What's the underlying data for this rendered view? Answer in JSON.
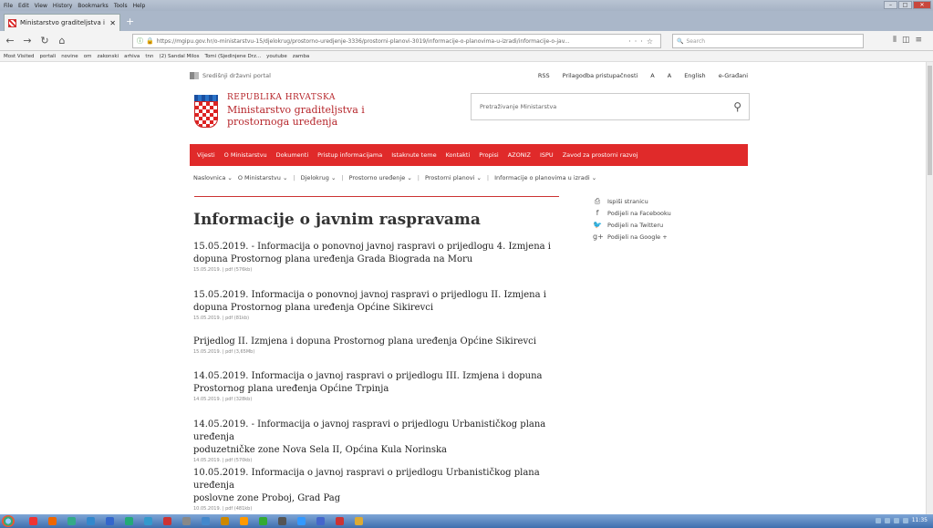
{
  "browser": {
    "menu": [
      "File",
      "Edit",
      "View",
      "History",
      "Bookmarks",
      "Tools",
      "Help"
    ],
    "tab_title": "Ministarstvo graditeljstva i pro...",
    "url": "https://mgipu.gov.hr/o-ministarstvu-15/djelokrug/prostorno-uredjenje-3336/prostorni-planovi-3019/informacije-o-planovima-u-izradi/informacije-o-jav...",
    "search_placeholder": "Search",
    "bookmarks": [
      "Most Visited",
      "portali",
      "novine",
      "om",
      "zakonski",
      "arhiva",
      "tnn",
      "(2) Sandal Milos",
      "Tomi (Sjedinjene Drz...",
      "youtube",
      "zamba"
    ]
  },
  "site": {
    "portal": "Središnji državni portal",
    "toplinks": [
      "RSS",
      "Prilagodba pristupačnosti",
      "A",
      "A",
      "English",
      "e-Građani"
    ],
    "title_line1": "REPUBLIKA HRVATSKA",
    "title_line2": "Ministarstvo graditeljstva i",
    "title_line3": "prostornoga uređenja",
    "search_placeholder": "Pretraživanje Ministarstva",
    "nav": [
      "Vijesti",
      "O Ministarstvu",
      "Dokumenti",
      "Pristup informacijama",
      "Istaknute teme",
      "Kontakti",
      "Propisi",
      "AZONIZ",
      "ISPU",
      "Zavod za prostorni razvoj"
    ],
    "breadcrumb": [
      "Naslovnica",
      "O Ministarstvu",
      "Djelokrug",
      "Prostorno uređenje",
      "Prostorni planovi",
      "Informacije o planovima u izradi"
    ],
    "heading": "Informacije o javnim raspravama",
    "articles": [
      {
        "line1": "15.05.2019. - Informacija o ponovnoj javnoj raspravi o prijedlogu 4. Izmjena i",
        "line2": "dopuna Prostornog plana uređenja Grada Biograda na Moru",
        "meta": "15.05.2019. | pdf (576kb)"
      },
      {
        "line1": "15.05.2019. Informacija o ponovnoj javnoj raspravi o prijedlogu II. Izmjena i",
        "line2": "dopuna Prostornog plana uređenja Općine Sikirevci",
        "meta": "15.05.2019. | pdf (81kb)"
      },
      {
        "line1": "Prijedlog II. Izmjena i dopuna Prostornog plana uređenja Općine Sikirevci",
        "line2": "",
        "meta": "15.05.2019. | pdf (3,65Mb)"
      },
      {
        "line1": "14.05.2019. Informacija o javnoj raspravi o prijedlogu III. Izmjena i dopuna",
        "line2": "Prostornog plana uređenja Općine Trpinja",
        "meta": "14.05.2019. | pdf (328kb)"
      },
      {
        "line1": "14.05.2019. - Informacija o javnoj raspravi o prijedlogu Urbanističkog plana uređenja",
        "line2": "poduzetničke zone Nova Sela II, Općina Kula Norinska",
        "meta": "14.05.2019. | pdf (570kb)"
      },
      {
        "line1": "10.05.2019. Informacija o javnoj raspravi o prijedlogu Urbanističkog plana uređenja",
        "line2": "poslovne zone Proboj, Grad Pag",
        "meta": "10.05.2019. | pdf (481kb)"
      }
    ],
    "sidebar": [
      {
        "icon": "print-icon",
        "label": "Ispiši stranicu"
      },
      {
        "icon": "facebook-icon",
        "label": "Podijeli na Facebooku"
      },
      {
        "icon": "twitter-icon",
        "label": "Podijeli na Twitteru"
      },
      {
        "icon": "google-plus-icon",
        "label": "Podijeli na Google +"
      }
    ]
  },
  "taskbar": {
    "clock": "11:35",
    "icon_colors": [
      "#e33",
      "#e60",
      "#3a8",
      "#38c",
      "#36c",
      "#2a7",
      "#39c",
      "#c33",
      "#888",
      "#48c",
      "#c80",
      "#f90",
      "#3a3",
      "#555",
      "#39f",
      "#46c",
      "#c33",
      "#da3"
    ]
  }
}
